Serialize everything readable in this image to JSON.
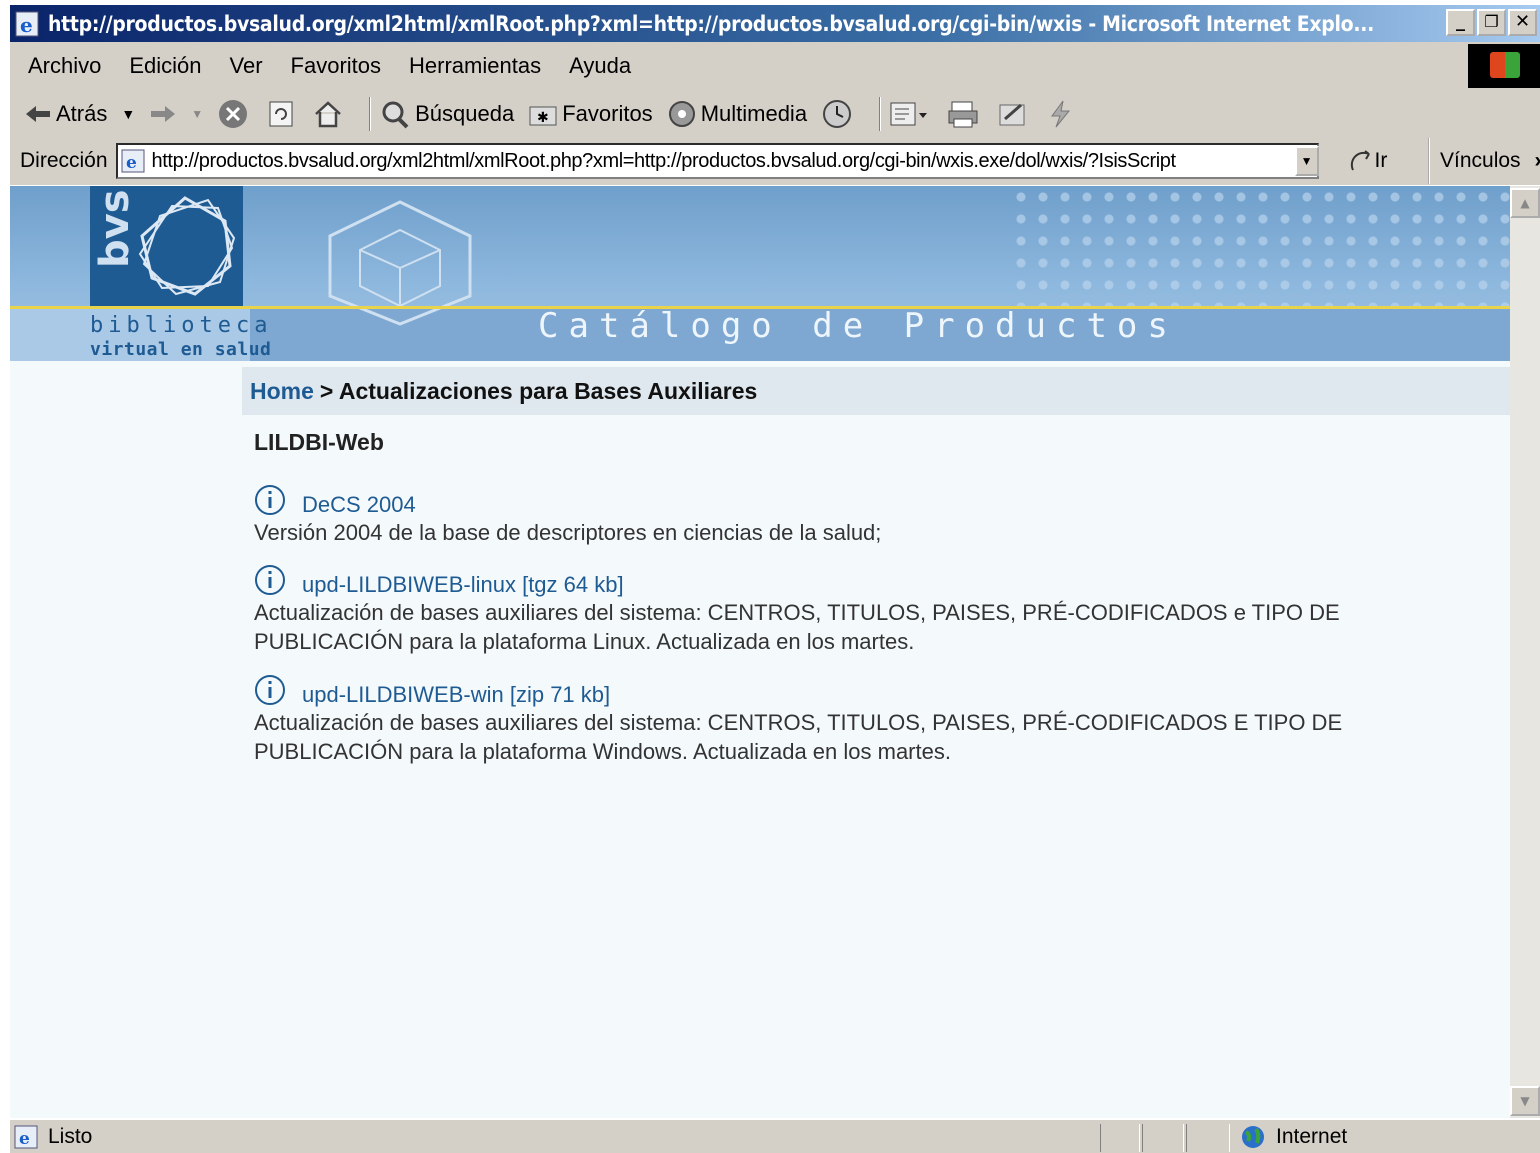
{
  "window": {
    "title": "http://productos.bvsalud.org/xml2html/xmlRoot.php?xml=http://productos.bvsalud.org/cgi-bin/wxis - Microsoft Internet Explo...",
    "minimize": "_",
    "maximize": "❐",
    "close": "✕"
  },
  "menu": [
    "Archivo",
    "Edición",
    "Ver",
    "Favoritos",
    "Herramientas",
    "Ayuda"
  ],
  "toolbar": {
    "back_label": "Atrás",
    "search_label": "Búsqueda",
    "favorites_label": "Favoritos",
    "multimedia_label": "Multimedia"
  },
  "address": {
    "label": "Dirección",
    "url": "http://productos.bvsalud.org/xml2html/xmlRoot.php?xml=http://productos.bvsalud.org/cgi-bin/wxis.exe/dol/wxis/?IsisScript",
    "go_label": "Ir",
    "links_label": "Vínculos"
  },
  "banner": {
    "logo_text": "bvs",
    "library_line1": "biblioteca",
    "library_line2": "virtual en salud",
    "catalog_title": "Catálogo de Productos"
  },
  "breadcrumb": {
    "home": "Home",
    "current": "> Actualizaciones para Bases Auxiliares"
  },
  "section": {
    "title": "LILDBI-Web"
  },
  "items": [
    {
      "link": "DeCS 2004",
      "desc": "Versión 2004 de la base de descriptores en ciencias de la salud;"
    },
    {
      "link": "upd-LILDBIWEB-linux [tgz 64 kb]",
      "desc": "Actualización de bases auxiliares del sistema: CENTROS, TITULOS, PAISES, PRÉ-CODIFICADOS e TIPO DE PUBLICACIÓN para la plataforma Linux. Actualizada en los martes."
    },
    {
      "link": "upd-LILDBIWEB-win [zip 71 kb]",
      "desc": "Actualización de bases auxiliares del sistema: CENTROS, TITULOS, PAISES, PRÉ-CODIFICADOS E TIPO DE PUBLICACIÓN para la plataforma Windows. Actualizada en los martes."
    }
  ],
  "status": {
    "text": "Listo",
    "zone": "Internet"
  },
  "colors": {
    "titlebar": "#0a246a",
    "link": "#1f5b93",
    "banner": "#7ea8d2",
    "chrome": "#d4d0c8"
  }
}
